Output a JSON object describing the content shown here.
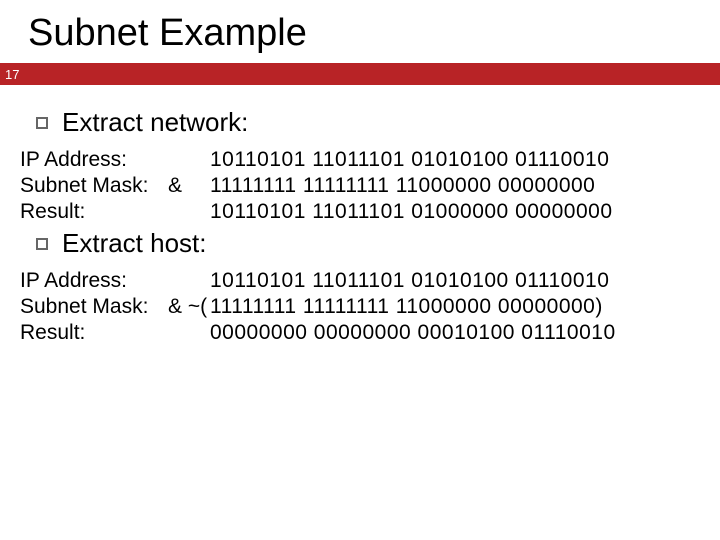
{
  "title": "Subnet Example",
  "slide_number": "17",
  "section1": {
    "heading": "Extract network:",
    "rows": {
      "ip_label": "IP Address:",
      "ip_op": "",
      "ip_bin": "10110101 11011101 01010100 01110010",
      "mask_label": "Subnet Mask:",
      "mask_op": "&",
      "mask_bin": "11111111 11111111 11000000 00000000",
      "res_label": "Result:",
      "res_op": "",
      "res_bin": "10110101 11011101 01000000 00000000"
    }
  },
  "section2": {
    "heading": "Extract host:",
    "rows": {
      "ip_label": "IP Address:",
      "ip_op": "",
      "ip_bin": "10110101 11011101 01010100 01110010",
      "mask_label": "Subnet Mask:",
      "mask_op": "& ~(",
      "mask_bin": "11111111 11111111 11000000 00000000)",
      "res_label": "Result:",
      "res_op": "",
      "res_bin": "00000000 00000000 00010100 01110010"
    }
  }
}
